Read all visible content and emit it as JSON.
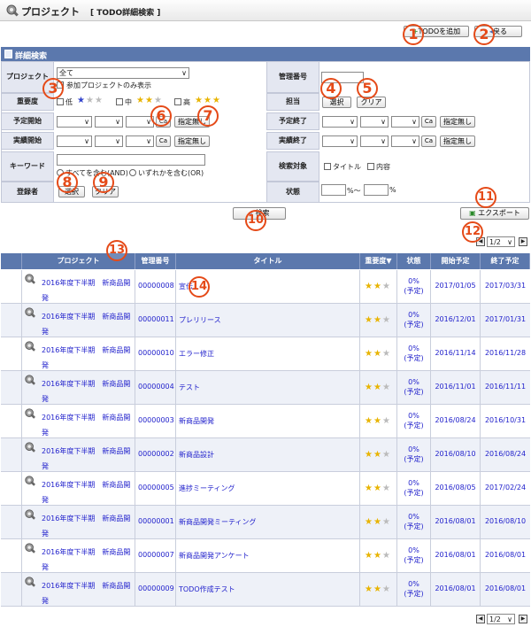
{
  "header": {
    "title": "プロジェクト",
    "subtitle": "[ TODO詳細検索 ]"
  },
  "toolbar": {
    "add_todo": "TODOを追加",
    "back": "戻る"
  },
  "search": {
    "section_title": "詳細検索",
    "project_label": "プロジェクト",
    "project_value": "全て",
    "participating_only": "参加プロジェクトのみ表示",
    "importance_label": "重要度",
    "importance_low": "低",
    "importance_mid": "中",
    "importance_high": "高",
    "planned_start_label": "予定開始",
    "actual_start_label": "実績開始",
    "keyword_label": "キーワード",
    "keyword_all": "すべてを含む(AND)",
    "keyword_any": "いずれかを含む(OR)",
    "registrant_label": "登録者",
    "select_button": "選択",
    "clear_button": "クリア",
    "unset_button": "指定無し",
    "cal_button": "Ca",
    "manage_no_label": "管理番号",
    "assignee_label": "担当",
    "planned_end_label": "予定終了",
    "actual_end_label": "実績終了",
    "target_label": "検索対象",
    "target_title": "タイトル",
    "target_content": "内容",
    "status_label": "状態",
    "status_from_suffix": "%～",
    "status_to_suffix": "%",
    "search_button": "検索",
    "export_button": "エクスポート"
  },
  "pagination": {
    "current": "1/2"
  },
  "table": {
    "columns": [
      "プロジェクト",
      "管理番号",
      "タイトル",
      "重要度▼",
      "状態",
      "開始予定",
      "終了予定"
    ],
    "rows": [
      {
        "project": "2016年度下半期　新商品開発",
        "no": "00000008",
        "title": "宣伝",
        "status": "0%",
        "status2": "(予定)",
        "start": "2017/01/05",
        "end": "2017/03/31"
      },
      {
        "project": "2016年度下半期　新商品開発",
        "no": "00000011",
        "title": "プレリリース",
        "status": "0%",
        "status2": "(予定)",
        "start": "2016/12/01",
        "end": "2017/01/31"
      },
      {
        "project": "2016年度下半期　新商品開発",
        "no": "00000010",
        "title": "エラー修正",
        "status": "0%",
        "status2": "(予定)",
        "start": "2016/11/14",
        "end": "2016/11/28"
      },
      {
        "project": "2016年度下半期　新商品開発",
        "no": "00000004",
        "title": "テスト",
        "status": "0%",
        "status2": "(予定)",
        "start": "2016/11/01",
        "end": "2016/11/11"
      },
      {
        "project": "2016年度下半期　新商品開発",
        "no": "00000003",
        "title": "新商品開発",
        "status": "0%",
        "status2": "(予定)",
        "start": "2016/08/24",
        "end": "2016/10/31"
      },
      {
        "project": "2016年度下半期　新商品開発",
        "no": "00000002",
        "title": "新商品設計",
        "status": "0%",
        "status2": "(予定)",
        "start": "2016/08/10",
        "end": "2016/08/24"
      },
      {
        "project": "2016年度下半期　新商品開発",
        "no": "00000005",
        "title": "進捗ミーティング",
        "status": "0%",
        "status2": "(予定)",
        "start": "2016/08/05",
        "end": "2017/02/24"
      },
      {
        "project": "2016年度下半期　新商品開発",
        "no": "00000001",
        "title": "新商品開発ミーティング",
        "status": "0%",
        "status2": "(予定)",
        "start": "2016/08/01",
        "end": "2016/08/10"
      },
      {
        "project": "2016年度下半期　新商品開発",
        "no": "00000007",
        "title": "新商品開発アンケート",
        "status": "0%",
        "status2": "(予定)",
        "start": "2016/08/01",
        "end": "2016/08/01"
      },
      {
        "project": "2016年度下半期　新商品開発",
        "no": "00000009",
        "title": "TODO作成テスト",
        "status": "0%",
        "status2": "(予定)",
        "start": "2016/08/01",
        "end": "2016/08/01"
      }
    ]
  },
  "callouts": [
    "1",
    "2",
    "3",
    "4",
    "5",
    "6",
    "7",
    "8",
    "9",
    "10",
    "11",
    "12",
    "13",
    "14"
  ],
  "colors": {
    "accent": "#5b78ad",
    "callout": "#e54a18",
    "star": "#e8b400"
  }
}
